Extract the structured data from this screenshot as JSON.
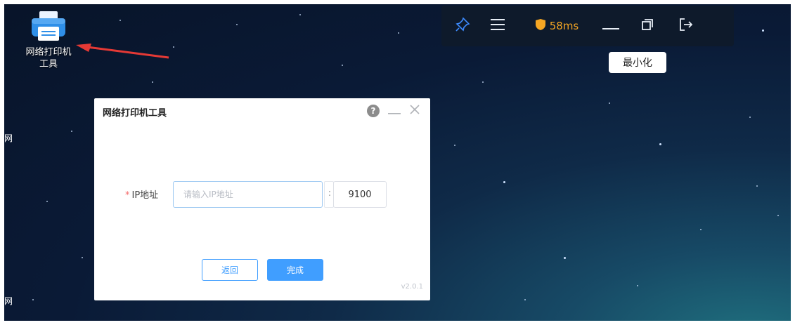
{
  "desktop_icon": {
    "label_line1": "网络打印机",
    "label_line2": "工具"
  },
  "edge_labels": [
    "网",
    "网"
  ],
  "toolbar": {
    "pin_icon": "pin-icon",
    "menu_icon": "menu-icon",
    "ping_icon": "shield-icon",
    "ping": "58ms",
    "minimize_icon": "minimize-icon",
    "restore_icon": "restore-icon",
    "exit_icon": "exit-icon"
  },
  "tooltip": "最小化",
  "dialog": {
    "title": "网络打印机工具",
    "ip_label": "IP地址",
    "ip_placeholder": "请输入IP地址",
    "colon": ":",
    "port_value": "9100",
    "back_label": "返回",
    "done_label": "完成",
    "version": "v2.0.1"
  },
  "colors": {
    "accent": "#409eff",
    "required": "#f56c6c",
    "ping": "#f5a623",
    "toolbar_bg": "#0e1a2b"
  }
}
